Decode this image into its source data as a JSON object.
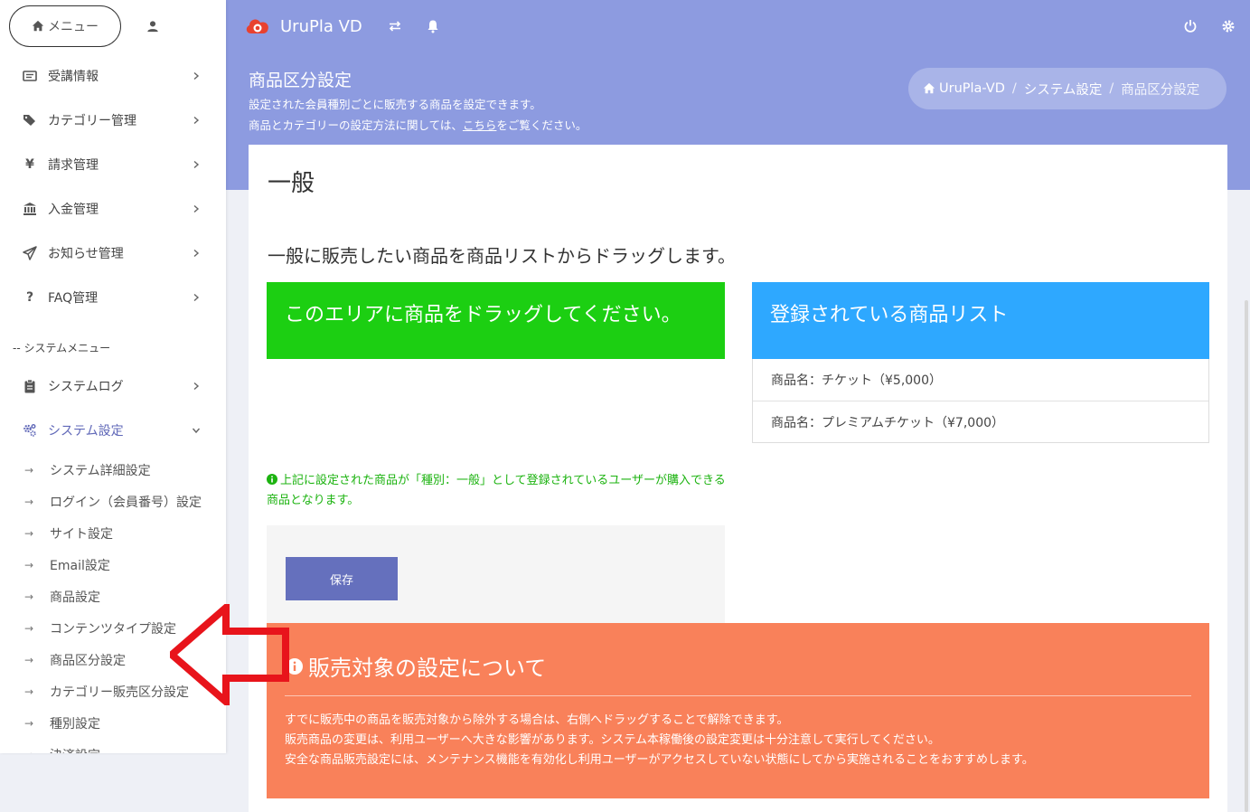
{
  "sidebar": {
    "menu_label": "メニュー",
    "items": [
      {
        "label": "受講情報",
        "icon": "id-card-icon"
      },
      {
        "label": "カテゴリー管理",
        "icon": "tags-icon"
      },
      {
        "label": "請求管理",
        "icon": "yen-icon"
      },
      {
        "label": "入金管理",
        "icon": "bank-icon"
      },
      {
        "label": "お知らせ管理",
        "icon": "paper-plane-icon"
      },
      {
        "label": "FAQ管理",
        "icon": "question-icon"
      }
    ],
    "system_header": "-- システムメニュー",
    "system_items": [
      {
        "label": "システムログ",
        "icon": "clipboard-icon"
      },
      {
        "label": "システム設定",
        "icon": "cogs-icon"
      }
    ],
    "sub_items": [
      "システム詳細設定",
      "ログイン（会員番号）設定",
      "サイト設定",
      "Email設定",
      "商品設定",
      "コンテンツタイプ設定",
      "商品区分設定",
      "カテゴリー販売区分設定",
      "種別設定",
      "決済設定"
    ],
    "sub_arrow": "→"
  },
  "header": {
    "brand": "UruPla VD",
    "bg_color": "#8d9be0"
  },
  "page": {
    "title": "商品区分設定",
    "desc_line1": "設定された会員種別ごとに販売する商品を設定できます。",
    "desc_line2_before": "商品とカテゴリーの設定方法に関しては、",
    "desc_link": "こちら",
    "desc_line2_after": "をご覧ください。"
  },
  "breadcrumb": {
    "home": "UruPla-VD",
    "sep": "/",
    "level1": "システム設定",
    "current": "商品区分設定"
  },
  "card": {
    "title": "一般",
    "subtitle": "一般に販売したい商品を商品リストからドラッグします。",
    "drop_area_label": "このエリアに商品をドラッグしてください。",
    "list_title": "登録されている商品リスト",
    "products": [
      "商品名：チケット（¥5,000）",
      "商品名：プレミアムチケット（¥7,000）"
    ],
    "note": "上記に設定された商品が「種別：一般」として登録されているユーザーが購入できる商品となります。",
    "save_label": "保存",
    "drop_color": "#1ccf12",
    "list_color": "#2ea8ff"
  },
  "alert": {
    "title": "販売対象の設定について",
    "line1": "すでに販売中の商品を販売対象から除外する場合は、右側へドラッグすることで解除できます。",
    "line2": "販売商品の変更は、利用ユーザーへ大きな影響があります。システム本稼働後の設定変更は十分注意して実行してください。",
    "line3": "安全な商品販売設定には、メンテナンス機能を有効化し利用ユーザーがアクセスしていない状態にしてから実施されることをおすすめします。",
    "color": "#f9815a"
  }
}
